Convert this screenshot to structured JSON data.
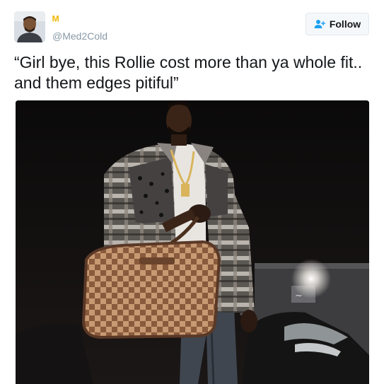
{
  "tweet": {
    "display_name": "ᴹ",
    "handle": "@Med2Cold",
    "follow_label": "Follow",
    "text": "“Girl bye, this Rollie cost more than ya whole fit.. and them edges pitiful”",
    "avatar_icon": "user-avatar",
    "follow_icon": "add-user-icon",
    "media_icon": "photo-of-man-with-checkered-bag",
    "colors": {
      "name": "#f2b705",
      "handle": "#8899a6",
      "text": "#14171a",
      "button_bg": "#f5f8fa",
      "button_border": "#e1e8ed",
      "accent": "#1da1f2"
    }
  }
}
